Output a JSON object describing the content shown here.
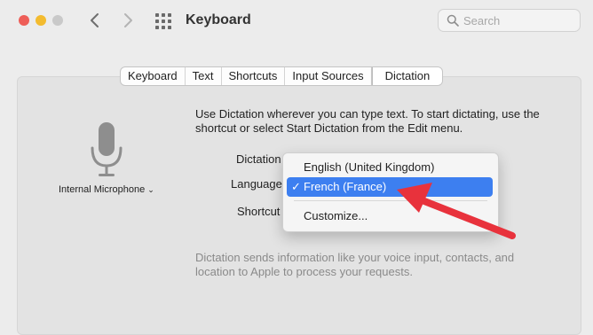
{
  "window": {
    "title": "Keyboard",
    "search": {
      "placeholder": "Search",
      "value": ""
    }
  },
  "tabs": [
    {
      "label": "Keyboard",
      "active": false
    },
    {
      "label": "Text",
      "active": false
    },
    {
      "label": "Shortcuts",
      "active": false
    },
    {
      "label": "Input Sources",
      "active": false
    },
    {
      "label": "Dictation",
      "active": true
    }
  ],
  "dictation": {
    "microphone_label": "Internal Microphone",
    "intro": "Use Dictation wherever you can type text. To start dictating, use the shortcut or select Start Dictation from the Edit menu.",
    "dictation_label": "Dictation",
    "language_label": "Language",
    "shortcut_label": "Shortcut",
    "footnote": "Dictation sends information like your voice input, contacts, and location to Apple to process your requests."
  },
  "language_menu": {
    "items": [
      {
        "label": "English (United Kingdom)",
        "selected": false
      },
      {
        "label": "French (France)",
        "selected": true,
        "check": "✓"
      },
      {
        "label": "Customize...",
        "selected": false
      }
    ]
  },
  "colors": {
    "selection": "#3d7ff0",
    "annotation_arrow": "#e8323c",
    "close": "#ee5e58",
    "minimize": "#f3bb2f"
  },
  "icons": [
    "chevron-left-icon",
    "chevron-right-icon",
    "grid-icon",
    "search-icon",
    "microphone-icon",
    "chevron-down-icon",
    "checkmark-icon"
  ]
}
